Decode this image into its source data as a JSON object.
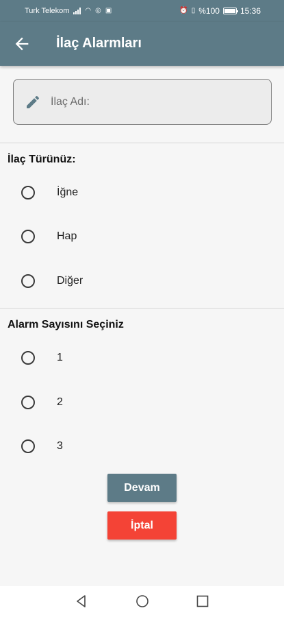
{
  "status_bar": {
    "carrier": "Turk Telekom",
    "battery": "%100",
    "time": "15:36"
  },
  "app_bar": {
    "title": "İlaç Alarmları",
    "back_icon": "arrow-back-icon"
  },
  "name_field": {
    "placeholder": "İlaç Adı:",
    "value": "",
    "icon": "pencil-icon"
  },
  "drug_type": {
    "title": "İlaç Türünüz:",
    "options": [
      "İğne",
      "Hap",
      "Diğer"
    ]
  },
  "alarm_count": {
    "title": "Alarm Sayısını Seçiniz",
    "options": [
      "1",
      "2",
      "3"
    ]
  },
  "buttons": {
    "continue": "Devam",
    "cancel": "İptal"
  },
  "colors": {
    "primary": "#5d7b87",
    "danger": "#f44336",
    "background": "#f6f6f6"
  }
}
